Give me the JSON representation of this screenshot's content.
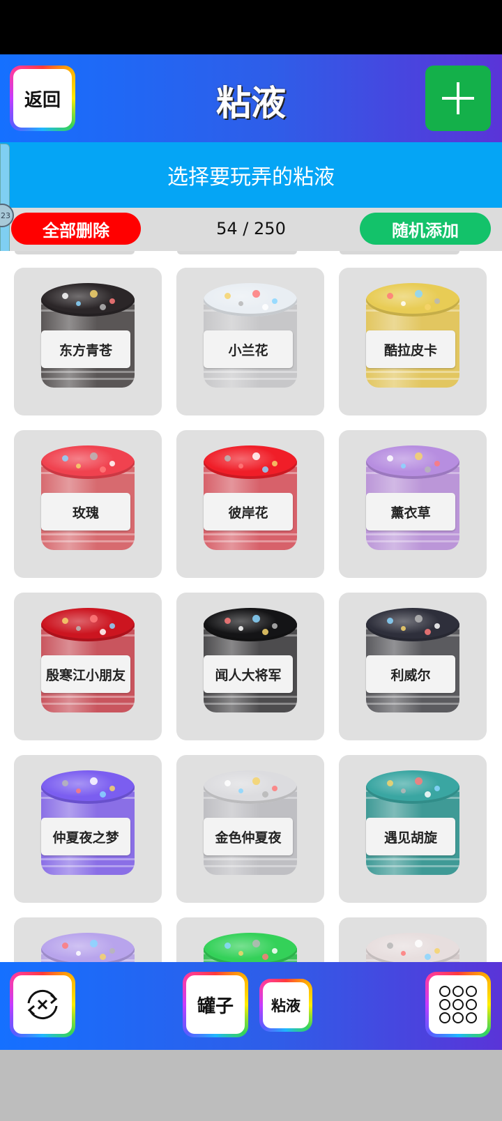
{
  "header": {
    "back_label": "返回",
    "title": "粘液",
    "add_icon": "plus-icon"
  },
  "subheader": {
    "text": "选择要玩弄的粘液"
  },
  "side_bubble": {
    "text": "23"
  },
  "actions": {
    "delete_all_label": "全部删除",
    "count": "54 / 250",
    "random_add_label": "随机添加"
  },
  "slimes": [
    {
      "name": "东方青苍",
      "color": "#2b2628",
      "base": "#5a5656"
    },
    {
      "name": "小兰花",
      "color": "#e9eef3",
      "base": "#c7c7c9"
    },
    {
      "name": "酷拉皮卡",
      "color": "#e8cc55",
      "base": "#e2c660"
    },
    {
      "name": "玫瑰",
      "color": "#f0424f",
      "base": "#d76a6f"
    },
    {
      "name": "彼岸花",
      "color": "#f01e28",
      "base": "#d7616a"
    },
    {
      "name": "薰衣草",
      "color": "#b78ee0",
      "base": "#bb96d8"
    },
    {
      "name": "殷寒江小朋友",
      "color": "#cc1520",
      "base": "#c9555e"
    },
    {
      "name": "闻人大将军",
      "color": "#141416",
      "base": "#4d4c4e"
    },
    {
      "name": "利威尔",
      "color": "#2e2f3b",
      "base": "#5b5b5f"
    },
    {
      "name": "仲夏夜之梦",
      "color": "#7b5ef0",
      "base": "#8a6fe6"
    },
    {
      "name": "金色仲夏夜",
      "color": "#dcdcdf",
      "base": "#bfbfc3"
    },
    {
      "name": "遇见胡旋",
      "color": "#3aa6a2",
      "base": "#3f9a96"
    },
    {
      "name": "",
      "color": "#b8a4ec",
      "base": "#b9a8e6"
    },
    {
      "name": "",
      "color": "#34d159",
      "base": "#3cc05c"
    },
    {
      "name": "",
      "color": "#e7dede",
      "base": "#d6cccc"
    }
  ],
  "bottom": {
    "reset_icon": "shuffle-cross-icon",
    "jar_label": "罐子",
    "slime_label": "粘液",
    "menu_icon": "grid-dots-icon"
  }
}
